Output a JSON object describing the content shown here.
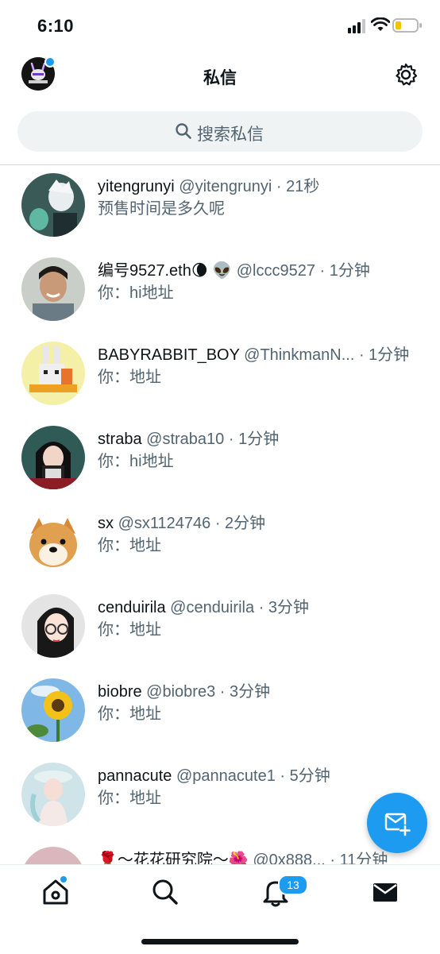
{
  "status_bar": {
    "time": "6:10"
  },
  "header": {
    "title": "私信"
  },
  "search": {
    "placeholder": "搜索私信"
  },
  "conversations": [
    {
      "name": "yitengrunyi",
      "handle": "@yitengrunyi",
      "time": "· 21秒",
      "preview": "预售时间是多久呢"
    },
    {
      "name": "编号9527.eth🌘 👽",
      "handle": "@lccc9527",
      "time": "· 1分钟",
      "preview": "你：hi地址"
    },
    {
      "name": "BABYRABBIT_BOY",
      "handle": "@ThinkmanN...",
      "time": "· 1分钟",
      "preview": "你：地址"
    },
    {
      "name": "straba",
      "handle": "@straba10",
      "time": "· 1分钟",
      "preview": "你：hi地址"
    },
    {
      "name": "sx",
      "handle": "@sx1124746",
      "time": "· 2分钟",
      "preview": "你：地址"
    },
    {
      "name": "cenduirila",
      "handle": "@cenduirila",
      "time": "· 3分钟",
      "preview": "你：地址"
    },
    {
      "name": "biobre",
      "handle": "@biobre3",
      "time": "· 3分钟",
      "preview": "你：地址"
    },
    {
      "name": "pannacute",
      "handle": "@pannacute1",
      "time": "· 5分钟",
      "preview": "你：地址"
    },
    {
      "name": "🌹～花花研究院～🌺",
      "handle": "@0x888...",
      "time": "· 11分钟",
      "preview": ""
    }
  ],
  "tabbar": {
    "notifications_badge": "13"
  },
  "icons": {
    "settings": "gear-icon",
    "search": "search-icon",
    "compose": "compose-message-icon",
    "home": "home-icon",
    "explore": "search-icon",
    "notifications": "bell-icon",
    "messages": "mail-icon"
  },
  "colors": {
    "accent": "#1d9bf0",
    "secondary_text": "#536471",
    "search_bg": "#eff3f4"
  }
}
